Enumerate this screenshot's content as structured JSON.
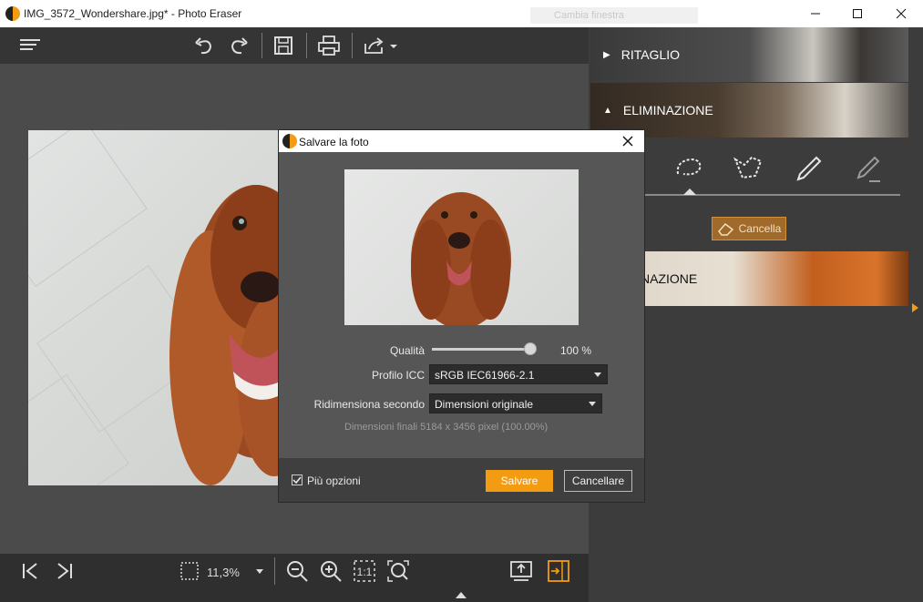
{
  "window": {
    "title": "IMG_3572_Wondershare.jpg* - Photo Eraser",
    "ghost_tab": "Cambia finestra"
  },
  "zoom": {
    "value": "11,3%"
  },
  "right_panel": {
    "sections": [
      {
        "label": "RITAGLIO"
      },
      {
        "label": "ELIMINAZIONE"
      },
      {
        "label": "NAZIONE"
      }
    ],
    "cancella_label": "Cancella"
  },
  "dialog": {
    "title": "Salvare la foto",
    "quality_label": "Qualità",
    "quality_value": "100 %",
    "quality_fraction": 1.0,
    "icc_label": "Profilo ICC",
    "icc_value": "sRGB IEC61966-2.1",
    "resize_label": "Ridimensiona secondo",
    "resize_value": "Dimensioni originale",
    "final_dims": "Dimensioni finali 5184 x 3456 pixel (100.00%)",
    "more_options": "Più opzioni",
    "more_options_checked": true,
    "save_label": "Salvare",
    "cancel_label": "Cancellare"
  },
  "colors": {
    "accent": "#f39c12",
    "panel": "#3c3c3c",
    "toolbar": "#353535"
  }
}
